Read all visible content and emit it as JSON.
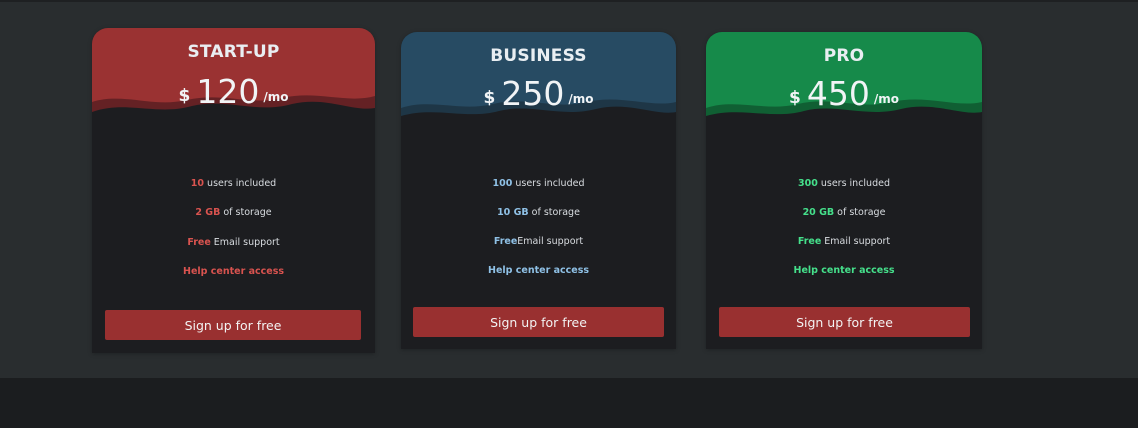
{
  "colors": {
    "startup": "#9a3232",
    "business": "#274b63",
    "pro": "#168a4a",
    "startup_accent": "#d9534f",
    "business_accent": "#8fc1e6",
    "pro_accent": "#45e08b",
    "button": "#993030"
  },
  "plans": [
    {
      "name": "START-UP",
      "currency": "$",
      "price": "120",
      "period": "/mo",
      "users_value": "10",
      "users_text": " users included",
      "storage_value": "2 GB",
      "storage_text": " of storage",
      "support_value": "Free",
      "support_text": " Email support",
      "help": "Help center access",
      "cta": "Sign up for free"
    },
    {
      "name": "BUSINESS",
      "currency": "$",
      "price": "250",
      "period": "/mo",
      "users_value": "100",
      "users_text": " users included",
      "storage_value": "10 GB",
      "storage_text": " of storage",
      "support_value": "Free",
      "support_text": "Email support",
      "help": "Help center access",
      "cta": "Sign up for free"
    },
    {
      "name": "PRO",
      "currency": "$",
      "price": "450",
      "period": "/mo",
      "users_value": "300",
      "users_text": " users included",
      "storage_value": "20 GB",
      "storage_text": " of storage",
      "support_value": "Free",
      "support_text": " Email support",
      "help": "Help center access",
      "cta": "Sign up for free"
    }
  ]
}
